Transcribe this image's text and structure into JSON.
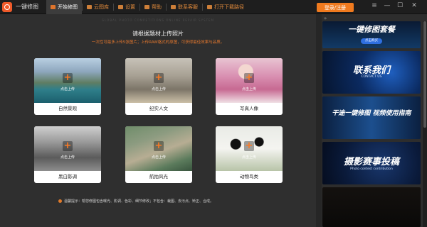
{
  "app": {
    "title": "一键修图"
  },
  "nav": [
    {
      "label": "开始修图",
      "icon": "camera-icon",
      "active": true
    },
    {
      "label": "云图库",
      "icon": "cloud-icon",
      "active": false
    },
    {
      "label": "设置",
      "icon": "gear-icon",
      "active": false
    },
    {
      "label": "帮助",
      "icon": "help-icon",
      "active": false
    },
    {
      "label": "联系客服",
      "icon": "chat-icon",
      "active": false
    },
    {
      "label": "打开下载路径",
      "icon": "folder-icon",
      "active": false
    }
  ],
  "login_label": "登录/注册",
  "window_controls": {
    "menu": "≡",
    "minimize": "—",
    "maximize": "☐",
    "close": "✕"
  },
  "main": {
    "watermark": "GLOBAL PHOTO COMPETITIONS ONLINE REPAIR SYSTEM",
    "headline": "请根据题材上传照片",
    "subline": "一次性可最多上传5张图片；上传RAW格式的原图，可获得最佳效果与品质。",
    "upload_text": "点击上传",
    "cards": [
      {
        "label": "自然景观"
      },
      {
        "label": "纪实人文"
      },
      {
        "label": "写真人像"
      },
      {
        "label": "黑白影调"
      },
      {
        "label": "航拍风光"
      },
      {
        "label": "动物鸟类"
      }
    ],
    "tip": "温馨提示：帮您修图包含曝光、影调、色彩、细节修改；不包含：裁图、去污点、矫正、合成。"
  },
  "side": {
    "collapse": "»",
    "banners": [
      {
        "title": "一键修图套餐",
        "sub": "",
        "button": "点击购买"
      },
      {
        "title": "联系我们",
        "sub": "CONTACT US",
        "button": ""
      },
      {
        "title": "干途一键修图 视频使用指南",
        "sub": "",
        "button": ""
      },
      {
        "title": "摄影赛事投稿",
        "sub": "Photo contest contribution",
        "button": ""
      },
      {
        "title": "",
        "sub": "",
        "button": ""
      }
    ]
  },
  "colors": {
    "accent": "#f07a1e",
    "background": "#2f2f2f",
    "topbar": "#1e1e1e"
  }
}
